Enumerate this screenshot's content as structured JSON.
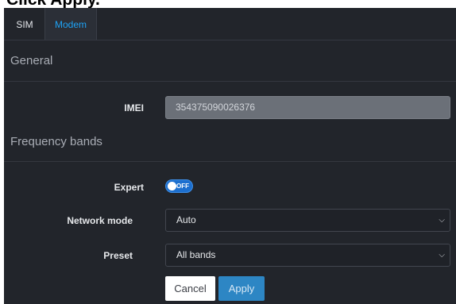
{
  "caption": "Click Apply.",
  "tabs": [
    {
      "label": "SIM",
      "active": false
    },
    {
      "label": "Modem",
      "active": true
    }
  ],
  "general": {
    "title": "General",
    "imei_label": "IMEI",
    "imei_value": "354375090026376"
  },
  "frequency": {
    "title": "Frequency bands",
    "expert_label": "Expert",
    "expert_toggle": "OFF",
    "network_mode_label": "Network mode",
    "network_mode_value": "Auto",
    "preset_label": "Preset",
    "preset_value": "All bands"
  },
  "buttons": {
    "cancel": "Cancel",
    "apply": "Apply"
  },
  "colors": {
    "panel_bg": "#22252b",
    "accent": "#1ea2f5",
    "apply_bg": "#2d86c4"
  },
  "icons": {
    "select_chevron": "chevron-down-icon"
  }
}
